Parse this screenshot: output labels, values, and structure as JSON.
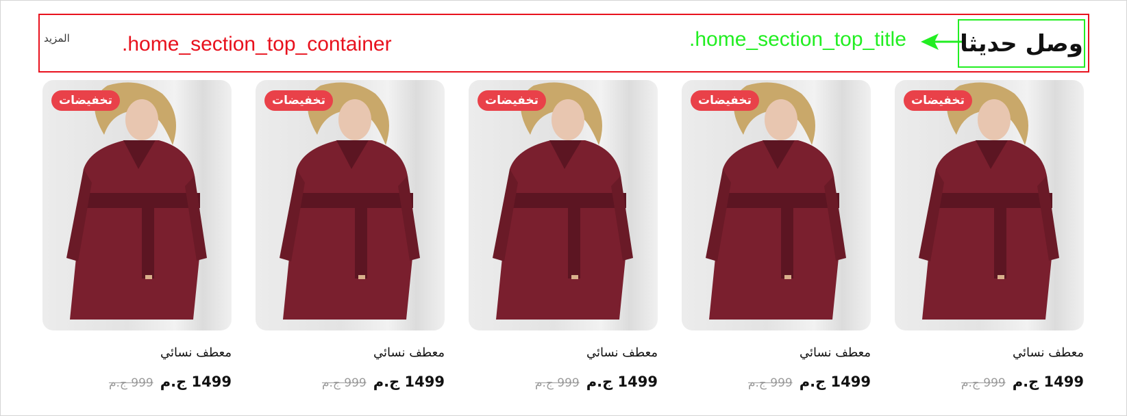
{
  "section": {
    "title": "وصل حديثا",
    "more_label": "المزيد",
    "annotations": {
      "container_class": ".home_section_top_container",
      "title_class": ".home_section_top_title"
    },
    "colors": {
      "container_outline": "#e8111d",
      "title_outline": "#22ee22",
      "sale_badge": "#e94149"
    }
  },
  "products": [
    {
      "name": "معطف نسائي",
      "price": "1499 ج.م",
      "old_price": "999 ج.م",
      "badge": "تخفيضات"
    },
    {
      "name": "معطف نسائي",
      "price": "1499 ج.م",
      "old_price": "999 ج.م",
      "badge": "تخفيضات"
    },
    {
      "name": "معطف نسائي",
      "price": "1499 ج.م",
      "old_price": "999 ج.م",
      "badge": "تخفيضات"
    },
    {
      "name": "معطف نسائي",
      "price": "1499 ج.م",
      "old_price": "999 ج.م",
      "badge": "تخفيضات"
    },
    {
      "name": "معطف نسائي",
      "price": "1499 ج.م",
      "old_price": "999 ج.م",
      "badge": "تخفيضات"
    }
  ]
}
